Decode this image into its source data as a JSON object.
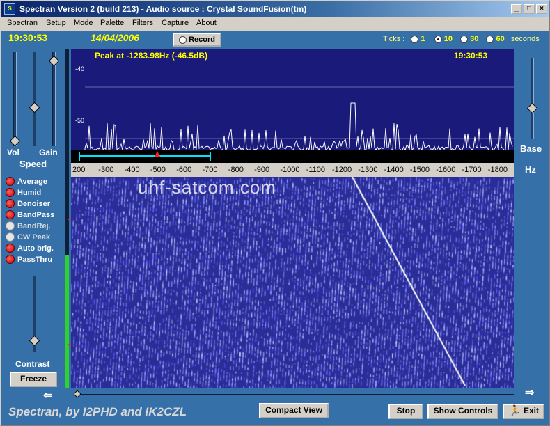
{
  "window": {
    "title": "Spectran Version 2  (build 213) - Audio source  :  Crystal SoundFusion(tm)",
    "icon_name": "spectran-app-icon"
  },
  "menu": [
    "Spectran",
    "Setup",
    "Mode",
    "Palette",
    "Filters",
    "Capture",
    "About"
  ],
  "header": {
    "time": "19:30:53",
    "date": "14/04/2006",
    "record_label": "Record",
    "ticks_label": "Ticks :",
    "tick_options": [
      "1",
      "10",
      "30",
      "60"
    ],
    "tick_selected": "10",
    "tick_unit": "seconds"
  },
  "left_sliders": {
    "vol_label": "Vol",
    "gain_label": "Gain",
    "speed_label": "Speed",
    "contrast_label": "Contrast"
  },
  "right_panel": {
    "base_label": "Base",
    "hz_label": "Hz"
  },
  "spectrum": {
    "peak_text": "Peak at -1283.98Hz (-46.5dB)",
    "time": "19:30:53",
    "db_labels": [
      "-40",
      "-50"
    ],
    "line_color": "#ffffff",
    "background": "#1a1a7a"
  },
  "frequency_scale": [
    "200",
    "-300",
    "-400",
    "-500",
    "-600",
    "-700",
    "-800",
    "-900",
    "-1000",
    "-1100",
    "-1200",
    "-1300",
    "-1400",
    "-1500",
    "-1600",
    "-1700",
    "-1800"
  ],
  "waterfall": {
    "watermark": "uhf-satcom.com",
    "base_color": "#2a2c98"
  },
  "features": [
    {
      "label": "Average",
      "on": true
    },
    {
      "label": "Humid",
      "on": true
    },
    {
      "label": "Denoiser",
      "on": true
    },
    {
      "label": "BandPass",
      "on": true
    },
    {
      "label": "BandRej.",
      "on": false
    },
    {
      "label": "CW Peak",
      "on": false
    },
    {
      "label": "Auto brig.",
      "on": true
    },
    {
      "label": "PassThru",
      "on": true
    }
  ],
  "buttons": {
    "freeze": "Freeze",
    "compact_view": "Compact View",
    "stop": "Stop",
    "show_controls": "Show Controls",
    "exit": "Exit"
  },
  "footer": {
    "credit": "Spectran, by I2PHD and IK2CZL"
  }
}
